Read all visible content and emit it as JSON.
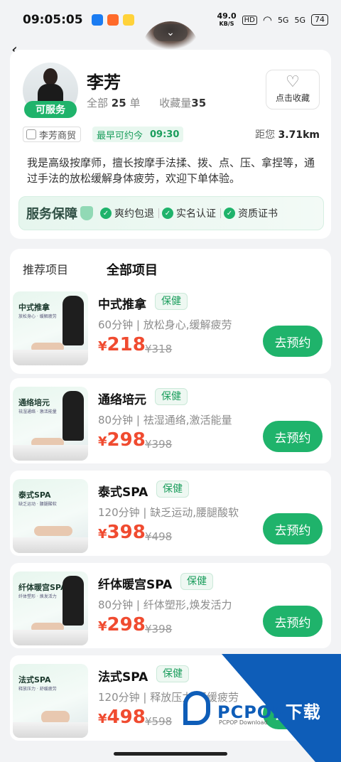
{
  "status_bar": {
    "time": "09:05:05",
    "net_speed_value": "49.0",
    "net_speed_unit": "KB/S",
    "hd": "HD",
    "signal1": "5G",
    "signal2": "5G",
    "battery": "74",
    "app_icon_colors": [
      "#1b7cf2",
      "#ff6a2a",
      "#ffd23a"
    ]
  },
  "header": {
    "back_icon": "chevron-left-icon",
    "collapse_icon": "chevron-down-icon"
  },
  "profile": {
    "name": "李芳",
    "status_badge": "可服务",
    "stats_all_label": "全部",
    "stats_orders": "25",
    "stats_orders_unit": "单",
    "stats_fav_label": "收藏量",
    "stats_fav": "35",
    "favorite_label": "点击收藏",
    "shop": "李芳商贸",
    "earliest_label": "最早可约今",
    "earliest_time": "09:30",
    "distance_label": "距您",
    "distance_value": "3.71km",
    "intro": "我是高级按摩师，擅长按摩手法揉、拨、点、压、拿捏等，通过手法的放松缓解身体疲劳，欢迎下单体验。"
  },
  "guarantee": {
    "title": "服务保障",
    "items": [
      "爽约包退",
      "实名认证",
      "资质证书"
    ]
  },
  "tabs": [
    {
      "label": "推荐项目"
    },
    {
      "label": "全部项目"
    }
  ],
  "services": [
    {
      "name": "中式推拿",
      "tag": "保健",
      "duration": "60分钟",
      "desc": "放松身心,缓解疲劳",
      "price": "218",
      "original": "¥318",
      "button": "去预约",
      "thumb_title": "中式推拿",
      "thumb_sub": "放松身心 · 缓解疲劳"
    },
    {
      "name": "通络培元",
      "tag": "保健",
      "duration": "80分钟",
      "desc": "祛湿通络,激活能量",
      "price": "298",
      "original": "¥398",
      "button": "去预约",
      "thumb_title": "通络培元",
      "thumb_sub": "祛湿通络 · 激活能量"
    },
    {
      "name": "泰式SPA",
      "tag": "保健",
      "duration": "120分钟",
      "desc": "缺乏运动,腰腿酸软",
      "price": "398",
      "original": "¥498",
      "button": "去预约",
      "thumb_title": "泰式SPA",
      "thumb_sub": "缺乏运动 · 腰腿酸软"
    },
    {
      "name": "纤体暖宫SPA",
      "tag": "保健",
      "duration": "80分钟",
      "desc": "纤体塑形,焕发活力",
      "price": "298",
      "original": "¥398",
      "button": "去预约",
      "thumb_title": "纤体暖宫SPA",
      "thumb_sub": "纤体塑形 · 焕发活力"
    },
    {
      "name": "法式SPA",
      "tag": "保健",
      "duration": "120分钟",
      "desc": "释放压力,舒缓疲劳",
      "price": "498",
      "original": "¥598",
      "button": "去预约",
      "thumb_title": "法式SPA",
      "thumb_sub": "释放压力 · 舒缓疲劳"
    }
  ],
  "currency": "¥",
  "watermark": {
    "brand_a": "PCPOP",
    "brand_b": "下载",
    "sub": "PCPOP Download"
  }
}
